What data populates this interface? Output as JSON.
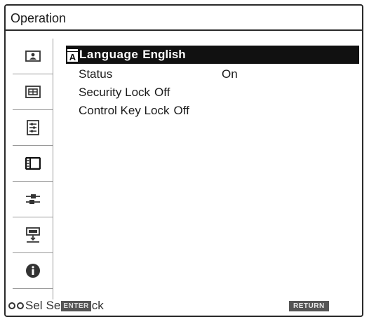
{
  "window": {
    "title": "Operation"
  },
  "sidebar": {
    "items": [
      {
        "icon": "picture-icon"
      },
      {
        "icon": "screen-icon"
      },
      {
        "icon": "setup-icon"
      },
      {
        "icon": "operation-icon"
      },
      {
        "icon": "connection-icon"
      },
      {
        "icon": "input-signal-icon"
      },
      {
        "icon": "information-icon"
      }
    ]
  },
  "menu": {
    "items": [
      {
        "label": "Language",
        "value": "English"
      },
      {
        "label": "Status",
        "value": "On"
      },
      {
        "label": "Security Lock",
        "value": "Off"
      },
      {
        "label": "Control Key Lock",
        "value": "Off"
      }
    ]
  },
  "footer": {
    "sel_label": "Sel",
    "set_prefix": "Se",
    "enter_badge": "ENTER",
    "back_suffix": "ck",
    "return_badge": "RETURN"
  }
}
